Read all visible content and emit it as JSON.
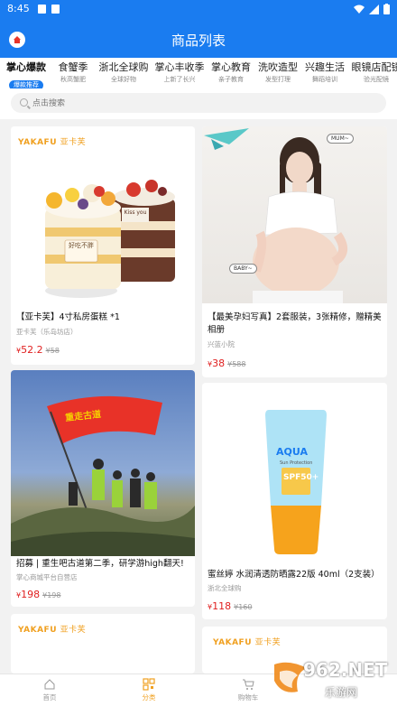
{
  "status": {
    "time": "8:45"
  },
  "header": {
    "title": "商品列表"
  },
  "categories": [
    {
      "name": "掌心爆款",
      "sub": "爆款推荐",
      "active": true
    },
    {
      "name": "食蟹季",
      "sub": "秋高蟹肥"
    },
    {
      "name": "浙北全球购",
      "sub": "全球好物"
    },
    {
      "name": "掌心丰收季",
      "sub": "上新了长兴"
    },
    {
      "name": "掌心教育",
      "sub": "亲子教育"
    },
    {
      "name": "洗吹造型",
      "sub": "发型打理"
    },
    {
      "name": "兴趣生活",
      "sub": "舞蹈培训"
    },
    {
      "name": "眼镜店配镜",
      "sub": "验光配镜"
    }
  ],
  "search": {
    "placeholder": "点击搜索"
  },
  "products": [
    {
      "title": "【亚卡芙】4寸私房蛋糕 *1",
      "shop": "亚卡芙（乐岛坊店）",
      "price": "52.2",
      "orig": "58",
      "brand": "YAKAFU",
      "brand_cn": "亚卡芙",
      "cake_tag": "好吃不胖",
      "cake_tag2": "Kiss you"
    },
    {
      "title": "【最美孕妇写真】2套服装，3张精修，赠精美相册",
      "shop": "兴蓝小院",
      "price": "38",
      "orig": "588",
      "bubble1": "MUM~",
      "bubble2": "BABY~"
    },
    {
      "title": "招募 | 重生吧古道第二季，研学游high翻天!",
      "shop": "掌心商城平台自营店",
      "price": "198",
      "orig": "198",
      "flag_text": "重走古道"
    },
    {
      "title": "蜜丝婷 水润清透防晒露22版 40ml（2支装）",
      "shop": "浙北全球购",
      "price": "118",
      "orig": "160",
      "bottle_brand": "AQUA",
      "bottle_spf": "SPF50+",
      "bottle_sub": "Sun Protection"
    },
    {
      "brand": "YAKAFU",
      "brand_cn": "亚卡芙"
    },
    {
      "brand": "YAKAFU",
      "brand_cn": "亚卡芙"
    }
  ],
  "tabs": [
    {
      "label": "首页"
    },
    {
      "label": "分类"
    },
    {
      "label": "购物车"
    }
  ],
  "watermark": {
    "text": "962.NET",
    "sub": "乐游网"
  },
  "colors": {
    "primary": "#1a7cf0",
    "price": "#e02020",
    "accent": "#f0a020"
  }
}
